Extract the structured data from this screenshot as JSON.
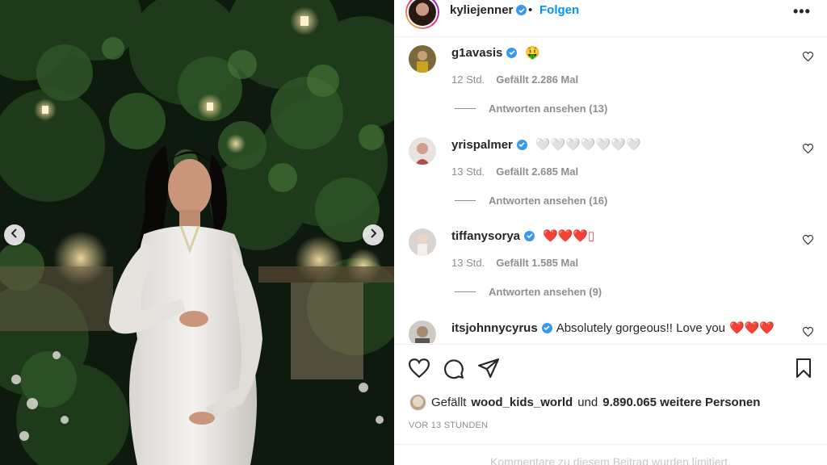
{
  "post": {
    "author": "kyliejenner",
    "separator": "•",
    "follow_label": "Folgen",
    "more_label": "•••"
  },
  "comments": [
    {
      "username": "g1avasis",
      "text": "",
      "emoji": "🤑",
      "time": "12 Std.",
      "likes": "Gefällt 2.286 Mal",
      "replies": "Antworten ansehen (13)"
    },
    {
      "username": "yrispalmer",
      "text": "",
      "emoji": "🤍🤍🤍🤍🤍🤍🤍",
      "time": "13 Std.",
      "likes": "Gefällt 2.685 Mal",
      "replies": "Antworten ansehen (16)"
    },
    {
      "username": "tiffanysorya",
      "text": "",
      "emoji": "❤️❤️❤️▯",
      "time": "13 Std.",
      "likes": "Gefällt 1.585 Mal",
      "replies": "Antworten ansehen (9)"
    },
    {
      "username": "itsjohnnycyrus",
      "text": "Absolutely gorgeous!! Love you",
      "emoji": "❤️❤️❤️",
      "time": "",
      "likes": "",
      "replies": ""
    }
  ],
  "likes_summary": {
    "prefix": "Gefällt",
    "liker": "wood_kids_world",
    "connector": "und",
    "count": "9.890.065 weitere Personen"
  },
  "timestamp": "VOR 13 STUNDEN",
  "comments_limited": "Kommentare zu diesem Beitrag wurden limitiert.",
  "icons": {
    "media_prev": "chevron-left-icon",
    "media_next": "chevron-right-icon",
    "like": "heart-icon",
    "comment": "comment-bubble-icon",
    "share": "paper-plane-icon",
    "save": "bookmark-icon",
    "verified": "verified-badge-icon"
  },
  "colors": {
    "link_blue": "#0095f6",
    "verified_blue": "#3897f0",
    "meta_gray": "#8e8e8e",
    "heart_red": "#ed4956"
  }
}
